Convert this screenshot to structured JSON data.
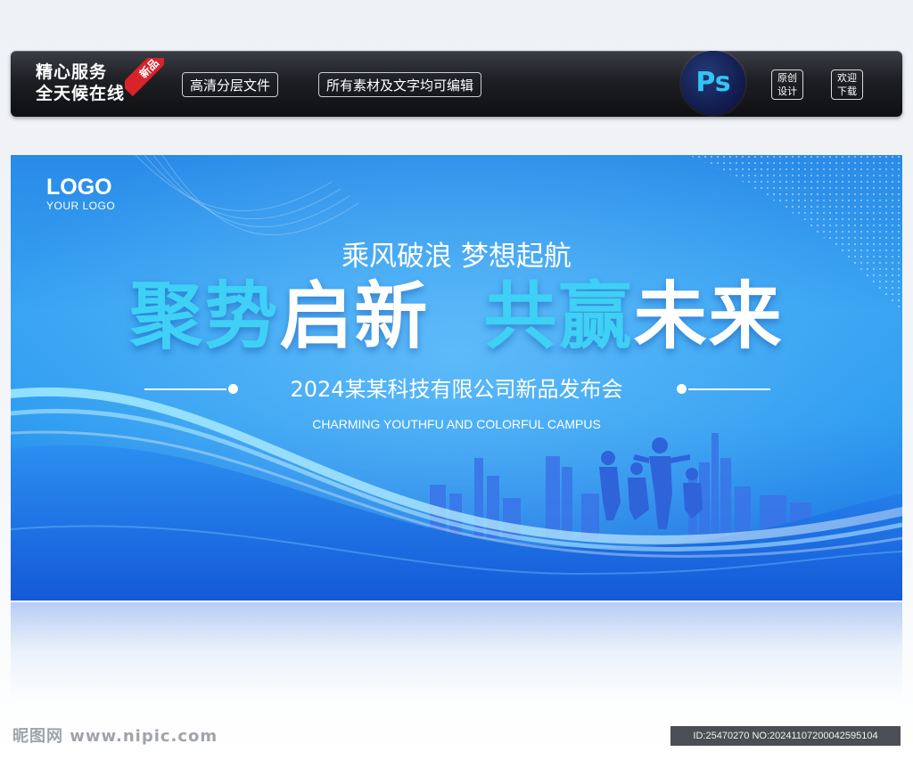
{
  "topbar": {
    "service_line1": "精心服务",
    "service_line2": "全天候在线",
    "ribbon": "新品",
    "pill_1": "高清分层文件",
    "pill_2": "所有素材及文字均可编辑",
    "ps_label": "Ps",
    "box_1_line1": "原创",
    "box_1_line2": "设计",
    "box_2_line1": "欢迎",
    "box_2_line2": "下载"
  },
  "banner": {
    "logo_big": "LOGO",
    "logo_small": "YOUR LOGO",
    "slogan": "乘风破浪 梦想起航",
    "headline_part1": "聚势",
    "headline_part2": "启新",
    "headline_part3": "共赢",
    "headline_part4": "未来",
    "event": "2024某某科技有限公司新品发布会",
    "english": "CHARMING YOUTHFU AND COLORFUL CAMPUS"
  },
  "footer": {
    "site": "昵图网 www.nipic.com",
    "id_text": "ID:25470270 NO:20241107200042595104"
  },
  "colors": {
    "accent_cyan": "#3fd0f5",
    "banner_blue": "#2d9bf0",
    "ribbon_red": "#d9222a",
    "ps_blue": "#31c5f4"
  }
}
